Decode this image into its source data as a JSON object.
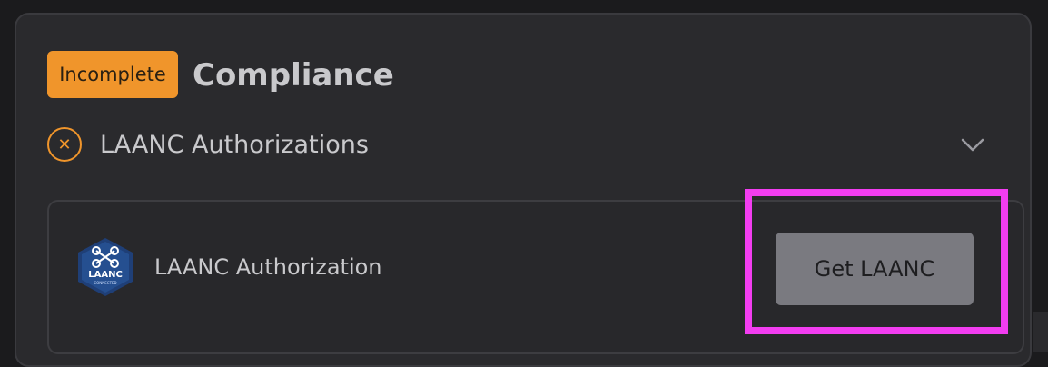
{
  "compliance": {
    "status_badge": "Incomplete",
    "title": "Compliance"
  },
  "laanc_section": {
    "label": "LAANC Authorizations",
    "status_icon": "close-icon",
    "expand_icon": "chevron-down-icon"
  },
  "laanc_card": {
    "label": "LAANC Authorization",
    "logo_text": "LAANC",
    "logo_subtext": "CONNECTED",
    "button_label": "Get LAANC"
  },
  "colors": {
    "accent_orange": "#f0952b",
    "highlight_magenta": "#f23df0",
    "button_gray": "#7a7a80",
    "logo_navy": "#1f3f77"
  }
}
